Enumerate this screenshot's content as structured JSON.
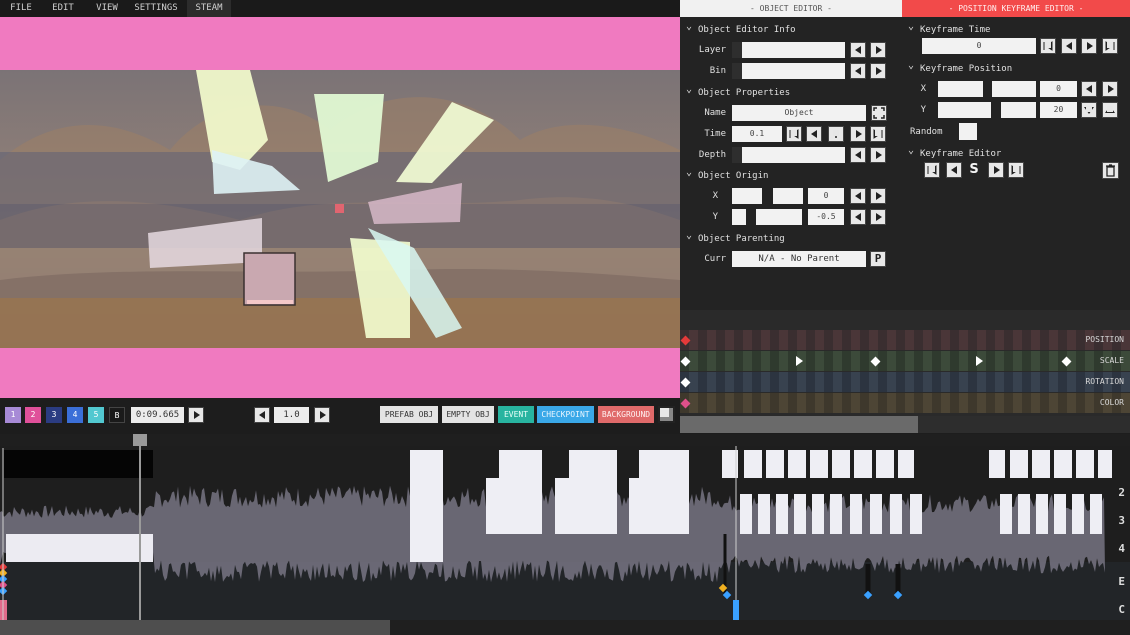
{
  "menu": [
    "FILE",
    "EDIT",
    "VIEW",
    "SETTINGS",
    "STEAM"
  ],
  "bins": [
    {
      "label": "1",
      "color": "#a78ad6"
    },
    {
      "label": "2",
      "color": "#e0509a"
    },
    {
      "label": "3",
      "color": "#2b3c82"
    },
    {
      "label": "4",
      "color": "#3b6fd8"
    },
    {
      "label": "5",
      "color": "#52c8d0"
    },
    {
      "label": "B",
      "color": "#1a1a1a"
    }
  ],
  "controls": {
    "time": "0:09.665",
    "speed": "1.0",
    "buttons": [
      {
        "label": "PREFAB OBJ",
        "bg": "#e4e4e4",
        "fg": "#333"
      },
      {
        "label": "EMPTY OBJ",
        "bg": "#e4e4e4",
        "fg": "#333"
      },
      {
        "label": "EVENT",
        "bg": "#28b4a0",
        "fg": "#e8fff8"
      },
      {
        "label": "CHECKPOINT",
        "bg": "#3aa8e8",
        "fg": "#eaf6ff"
      },
      {
        "label": "BACKGROUND",
        "bg": "#e06a6a",
        "fg": "#fff0f0"
      }
    ]
  },
  "object_editor": {
    "title": "- OBJECT EDITOR -",
    "info_header": "Object Editor Info",
    "layer_label": "Layer",
    "bin_label": "Bin",
    "props_header": "Object Properties",
    "name_label": "Name",
    "name_value": "Object",
    "time_label": "Time",
    "time_value": "0.1",
    "depth_label": "Depth",
    "origin_header": "Object Origin",
    "x_label": "X",
    "origin_x": "0",
    "y_label": "Y",
    "origin_y": "-0.5",
    "parent_header": "Object Parenting",
    "curr_label": "Curr",
    "parent_value": "N/A - No Parent"
  },
  "position_editor": {
    "title": "- POSITION KEYFRAME EDITOR -",
    "kf_time_header": "Keyframe Time",
    "kf_time_value": "0",
    "kf_pos_header": "Keyframe Position",
    "x_label": "X",
    "x_value": "0",
    "y_label": "Y",
    "y_value": "20",
    "random_label": "Random",
    "kf_editor_header": "Keyframe Editor",
    "kf_editor_letter": "S"
  },
  "keyframe_rows": [
    {
      "label": "POSITION",
      "color": "#3a2e30",
      "stripe": "#4a3638",
      "marker": "#e53a3a"
    },
    {
      "label": "SCALE",
      "color": "#2f3a2e",
      "stripe": "#3c4a3a",
      "marker": "#ffffff"
    },
    {
      "label": "ROTATION",
      "color": "#2c3440",
      "stripe": "#38424f",
      "marker": "#ffffff"
    },
    {
      "label": "COLOR",
      "color": "#3e382c",
      "stripe": "#4d4535",
      "marker": "#e0508a"
    }
  ],
  "timeline": {
    "layers": [
      "2",
      "3",
      "4",
      "E",
      "C"
    ]
  },
  "colors": {
    "accent_red": "#f24a4a",
    "pink_bg": "#f07ac0",
    "panel": "#232323"
  }
}
